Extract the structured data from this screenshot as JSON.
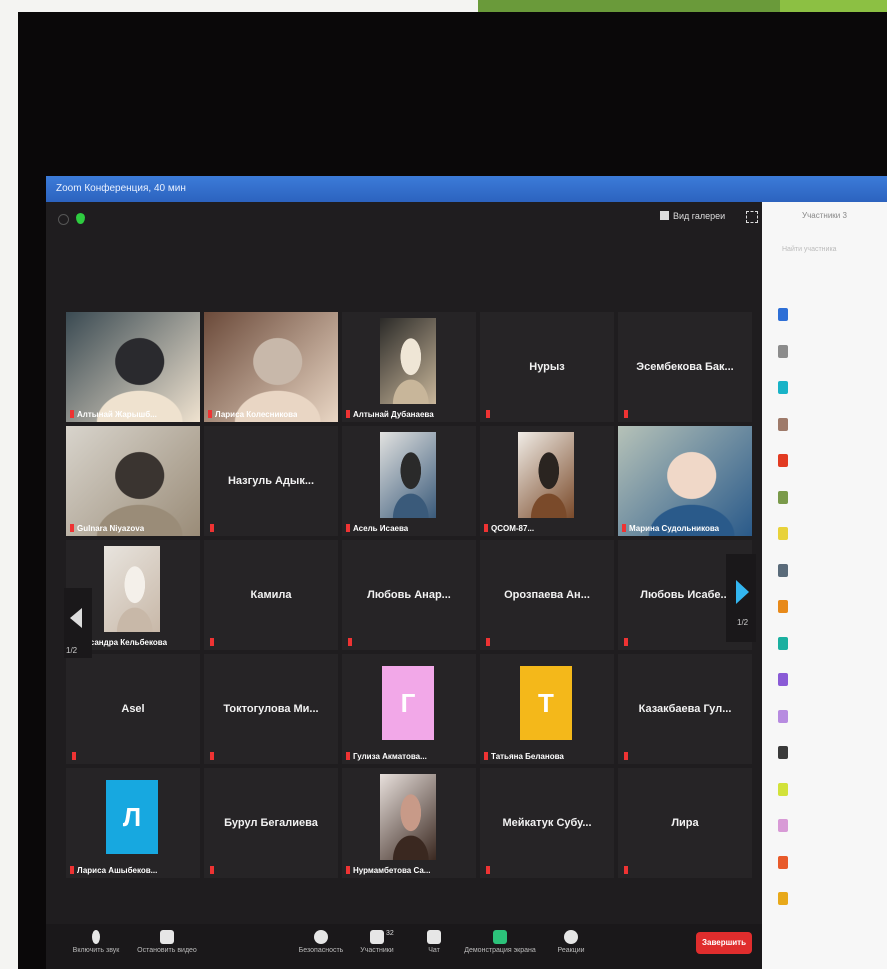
{
  "window": {
    "title": "Zoom Конференция, 40 мин"
  },
  "top_bar": {
    "view_label": "Вид галереи"
  },
  "participants_panel": {
    "title": "Участники 3",
    "search_placeholder": "Найти участника",
    "avatar_colors": [
      "#2e6fd6",
      "#8c8c8c",
      "#19b3c7",
      "#9e7a6a",
      "#e23b22",
      "#7a9a4a",
      "#e8d23a",
      "#5a6b7a",
      "#e88a1a",
      "#1bb0a0",
      "#8a5bd6",
      "#b78be0",
      "#3a3a3a",
      "#d2e23a",
      "#d89ad6",
      "#e85a2a",
      "#e8a91a"
    ]
  },
  "gallery": {
    "page_left": "1/2",
    "page_right": "1/2",
    "tiles": [
      {
        "label": "Алтынай Жарышб...",
        "kind": "video",
        "palette": [
          "#3a4a52",
          "#efe2cf",
          "#2a2a2e"
        ]
      },
      {
        "label": "Лариса Колесникова",
        "kind": "video",
        "palette": [
          "#6b4a3a",
          "#e9d6c4",
          "#c8b8aa"
        ]
      },
      {
        "label": "Алтынай Дубанаева",
        "kind": "video",
        "palette": [
          "#2b2a28",
          "#c8b69a",
          "#efe6d6"
        ]
      },
      {
        "name": "Нурыз",
        "kind": "name"
      },
      {
        "name": "Эсембекова Бак...",
        "kind": "name"
      },
      {
        "label": "Gulnara Niyazova",
        "kind": "video",
        "palette": [
          "#d8d4cc",
          "#9a8c78",
          "#3a3430"
        ]
      },
      {
        "name": "Назгуль Адык...",
        "kind": "name"
      },
      {
        "label": "Асель Исаева",
        "kind": "video",
        "palette": [
          "#e2e2e0",
          "#3a5a7a",
          "#2a2a2a"
        ]
      },
      {
        "label": "QCOM-87...",
        "kind": "video",
        "palette": [
          "#f0ece6",
          "#7a4a2a",
          "#2a2420"
        ]
      },
      {
        "label": "Марина Судольникова",
        "kind": "video",
        "palette": [
          "#b6c2b8",
          "#2a5a8a",
          "#f0d8c8"
        ],
        "active": true
      },
      {
        "label": "..ександра Кельбекова",
        "kind": "video",
        "palette": [
          "#e8e4de",
          "#c8b8a8",
          "#f4f0ea"
        ]
      },
      {
        "name": "Камила",
        "kind": "name"
      },
      {
        "name": "Любовь Анар...",
        "kind": "name"
      },
      {
        "name": "Орозпаева Ан...",
        "kind": "name"
      },
      {
        "name": "Любовь Исабе...",
        "kind": "name"
      },
      {
        "name": "Asel",
        "kind": "name"
      },
      {
        "name": "Токтогулова Ми...",
        "kind": "name"
      },
      {
        "label": "Гулиза Акматова...",
        "kind": "avatar",
        "letter": "Г",
        "color": "#f2a8e8"
      },
      {
        "label": "Татьяна Беланова",
        "kind": "avatar",
        "letter": "Т",
        "color": "#f4b81a"
      },
      {
        "name": "Казакбаева Гул...",
        "kind": "name"
      },
      {
        "label": "Лариса Ашыбеков...",
        "kind": "avatar",
        "letter": "Л",
        "color": "#17a8e0"
      },
      {
        "name": "Бурул Бегалиева",
        "kind": "name"
      },
      {
        "label": "Нурмамбетова Са...",
        "kind": "video",
        "palette": [
          "#e8e0dc",
          "#3a2820",
          "#c89a88"
        ]
      },
      {
        "name": "Мейкатук Субу...",
        "kind": "name"
      },
      {
        "name": "Лира",
        "kind": "name"
      }
    ]
  },
  "toolbar": {
    "mute": "Включить звук",
    "video": "Остановить видео",
    "security": "Безопасность",
    "participants": "Участники",
    "participants_count": "32",
    "chat": "Чат",
    "share": "Демонстрация экрана",
    "reactions": "Реакции",
    "end": "Завершить"
  },
  "colors": {
    "titlebar": "#2c63bf",
    "tile_bg": "#262426",
    "active_speaker": "#d8e86a",
    "end_button": "#e02d2d",
    "share_green": "#2cc27a",
    "nav_arrow": "#33b6f0"
  }
}
